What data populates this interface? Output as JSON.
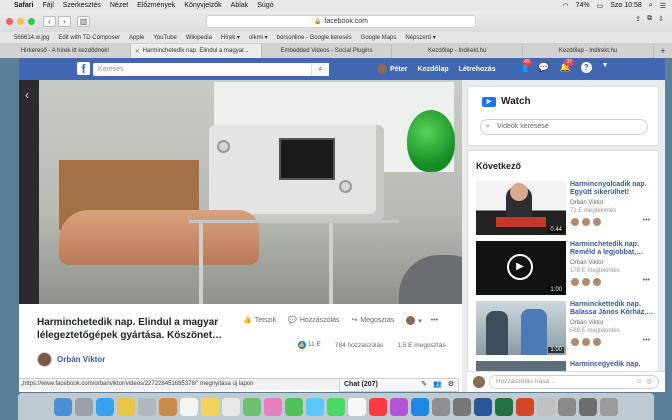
{
  "menubar": {
    "items": [
      "Safari",
      "Fájl",
      "Szerkesztés",
      "Nézet",
      "Előzmények",
      "Könyvjelzők",
      "Ablak",
      "Súgó"
    ],
    "battery": "74%",
    "clock": "Szo 10:58"
  },
  "toolbar": {
    "url": "facebook.com"
  },
  "bookmarks": [
    "566614.w.jpg",
    "Edit with TD Composer",
    "Apple",
    "YouTube",
    "Wikipedia",
    "Hírek ▾",
    "olkmi ▾",
    "borsonline - Google keresés",
    "Google Maps",
    "Népszerű ▾"
  ],
  "tabs": [
    {
      "label": "Hírkereső - A hírek itt kezdődnek!",
      "active": false
    },
    {
      "label": "Harminchetedik nap. Elindul a magyar...",
      "active": true
    },
    {
      "label": "Embedded Videos - Social Plugins",
      "active": false
    },
    {
      "label": "Kezdőlap - Indirekt.hu",
      "active": false
    },
    {
      "label": "Kezdőlap - Indirekt.hu",
      "active": false
    }
  ],
  "fb": {
    "search_placeholder": "Keresés",
    "nav": {
      "profile": "Péter",
      "home": "Kezdőlap",
      "create": "Létrehozás"
    },
    "badges": {
      "friends": "49",
      "notifications": "37"
    }
  },
  "video": {
    "title": "Harminchetedik nap. Elindul a magyar lélegeztetőgépek gyártása. Köszönet…",
    "actions": {
      "like": "Tetszik",
      "comment": "Hozzászólás",
      "share": "Megosztás"
    },
    "author": "Orbán Viktor",
    "stats": {
      "likes": "11 E",
      "comments": "784 hozzászólás",
      "shares": "1,5 E megosztás"
    }
  },
  "statusbar": "„https://www.facebook.com/orbanviktor/videos/227228451685378/” megnyitása új lapon",
  "watch": {
    "title": "Watch",
    "search_placeholder": "Videók keresése"
  },
  "next": {
    "heading": "Következő",
    "items": [
      {
        "title": "Harmincnyolcadik nap. Együtt sikerülhet!",
        "author": "Orbán Viktor",
        "views": "71 E megtekintés",
        "duration": "0:44"
      },
      {
        "title": "Harminchetedik nap. Reméld a legjobbat,…",
        "author": "Orbán Viktor",
        "views": "178 E megtekintés",
        "duration": "1:00"
      },
      {
        "title": "Harminckettedik nap. Balassa János Kórház,…",
        "author": "Orbán Viktor",
        "views": "569 E megtekintés",
        "duration": "1:00"
      },
      {
        "title": "Harmincegyedik nap.",
        "author": "",
        "views": "",
        "duration": ""
      }
    ]
  },
  "chat": {
    "label": "Chat (207)"
  },
  "comment": {
    "placeholder": "Hozzászólás írása…"
  },
  "colors": {
    "fb_blue": "#4267b2",
    "link": "#385898",
    "like_blue": "#2078f4",
    "badge_red": "#fa3e3e"
  }
}
